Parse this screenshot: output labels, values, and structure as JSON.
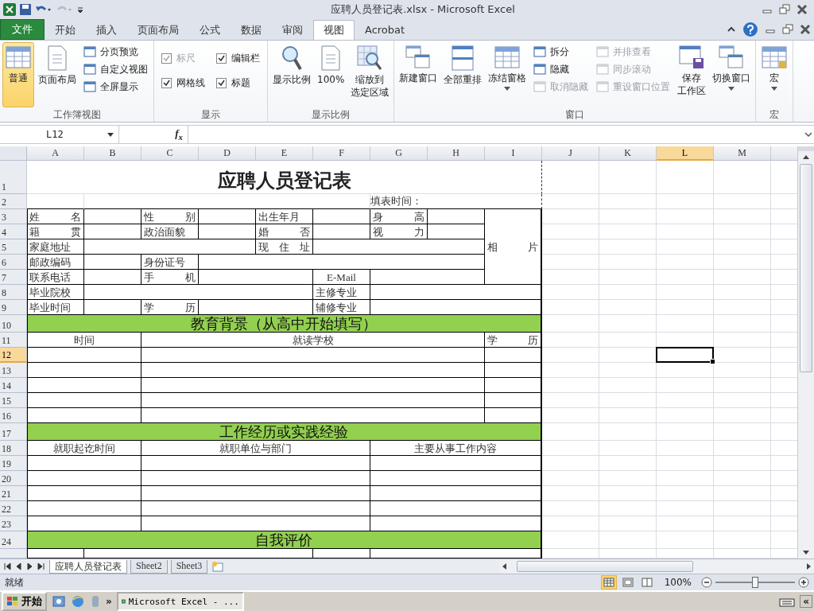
{
  "window": {
    "title": "应聘人员登记表.xlsx - Microsoft Excel"
  },
  "ribbon": {
    "file_tab": "文件",
    "tabs": [
      {
        "label": "开始",
        "selected": false
      },
      {
        "label": "插入",
        "selected": false
      },
      {
        "label": "页面布局",
        "selected": false
      },
      {
        "label": "公式",
        "selected": false
      },
      {
        "label": "数据",
        "selected": false
      },
      {
        "label": "审阅",
        "selected": false
      },
      {
        "label": "视图",
        "selected": true
      },
      {
        "label": "Acrobat",
        "selected": false
      }
    ],
    "groups": [
      {
        "label": "工作簿视图",
        "items": [
          {
            "kind": "large",
            "label": "普通",
            "selected": true,
            "dropdown": false
          },
          {
            "kind": "large",
            "label": "页面布局",
            "selected": false,
            "dropdown": false
          },
          {
            "kind": "small",
            "label": "分页预览",
            "disabled": false
          },
          {
            "kind": "small",
            "label": "自定义视图",
            "disabled": false
          },
          {
            "kind": "small",
            "label": "全屏显示",
            "disabled": false
          }
        ]
      },
      {
        "label": "显示",
        "items": [
          {
            "kind": "check",
            "label": "标尺",
            "checked": true,
            "disabled": true
          },
          {
            "kind": "check",
            "label": "网格线",
            "checked": true,
            "disabled": false
          },
          {
            "kind": "check",
            "label": "编辑栏",
            "checked": true,
            "disabled": false
          },
          {
            "kind": "check",
            "label": "标题",
            "checked": true,
            "disabled": false
          }
        ]
      },
      {
        "label": "显示比例",
        "items": [
          {
            "kind": "large",
            "label": "显示比例",
            "selected": false,
            "dropdown": false
          },
          {
            "kind": "large",
            "label": "100%",
            "selected": false,
            "dropdown": false
          },
          {
            "kind": "large",
            "label": "缩放到",
            "label_2": "选定区域",
            "selected": false,
            "dropdown": false
          }
        ]
      },
      {
        "label": "窗口",
        "items": [
          {
            "kind": "large",
            "label": "新建窗口",
            "selected": false,
            "dropdown": false
          },
          {
            "kind": "large",
            "label": "全部重排",
            "selected": false,
            "dropdown": false
          },
          {
            "kind": "large",
            "label": "冻结窗格",
            "selected": false,
            "dropdown": true
          },
          {
            "kind": "small",
            "label": "拆分",
            "disabled": false
          },
          {
            "kind": "small",
            "label": "隐藏",
            "disabled": false
          },
          {
            "kind": "small",
            "label": "取消隐藏",
            "disabled": true
          },
          {
            "kind": "small",
            "label": "并排查看",
            "disabled": true
          },
          {
            "kind": "small",
            "label": "同步滚动",
            "disabled": true
          },
          {
            "kind": "small",
            "label": "重设窗口位置",
            "disabled": true
          },
          {
            "kind": "large",
            "label": "保存",
            "label_2": "工作区",
            "selected": false,
            "dropdown": false
          },
          {
            "kind": "large",
            "label": "切换窗口",
            "selected": false,
            "dropdown": true
          }
        ]
      },
      {
        "label": "宏",
        "items": [
          {
            "kind": "large",
            "label": "宏",
            "selected": false,
            "dropdown": true
          }
        ]
      }
    ]
  },
  "formula_bar": {
    "name_box": "L12",
    "fx": "f$_{x}$"
  },
  "sheet": {
    "column_headers": [
      {
        "label": "A",
        "selected": false
      },
      {
        "label": "B",
        "selected": false
      },
      {
        "label": "C",
        "selected": false
      },
      {
        "label": "D",
        "selected": false
      },
      {
        "label": "E",
        "selected": false
      },
      {
        "label": "F",
        "selected": false
      },
      {
        "label": "G",
        "selected": false
      },
      {
        "label": "H",
        "selected": false
      },
      {
        "label": "I",
        "selected": false
      },
      {
        "label": "J",
        "selected": false
      },
      {
        "label": "K",
        "selected": false
      },
      {
        "label": "L",
        "selected": true
      },
      {
        "label": "M",
        "selected": false
      }
    ],
    "row_headers": [
      {
        "label": "1",
        "selected": false
      },
      {
        "label": "2",
        "selected": false
      },
      {
        "label": "3",
        "selected": false
      },
      {
        "label": "4",
        "selected": false
      },
      {
        "label": "5",
        "selected": false
      },
      {
        "label": "6",
        "selected": false
      },
      {
        "label": "7",
        "selected": false
      },
      {
        "label": "8",
        "selected": false
      },
      {
        "label": "9",
        "selected": false
      },
      {
        "label": "10",
        "selected": false
      },
      {
        "label": "11",
        "selected": false
      },
      {
        "label": "12",
        "selected": true
      },
      {
        "label": "13",
        "selected": false
      },
      {
        "label": "14",
        "selected": false
      },
      {
        "label": "15",
        "selected": false
      },
      {
        "label": "16",
        "selected": false
      },
      {
        "label": "17",
        "selected": false
      },
      {
        "label": "18",
        "selected": false
      },
      {
        "label": "19",
        "selected": false
      },
      {
        "label": "20",
        "selected": false
      },
      {
        "label": "21",
        "selected": false
      },
      {
        "label": "22",
        "selected": false
      },
      {
        "label": "23",
        "selected": false
      },
      {
        "label": "24",
        "selected": false
      }
    ],
    "title": "应聘人员登记表",
    "fill_time": "填表时间：",
    "photo": "相 片",
    "fields": [
      "姓 名",
      "性 别",
      "出生年月",
      "身 高",
      "籍 贯",
      "政治面貌",
      "婚 否",
      "视 力",
      "家庭地址",
      "现 住 址",
      "邮政编码",
      "身份证号",
      "联系电话",
      "手 机",
      "E-Mail",
      "毕业院校",
      "主修专业",
      "毕业时间",
      "学 历",
      "辅修专业"
    ],
    "education": {
      "heading": "教育背景（从高中开始填写）",
      "columns": [
        "时间",
        "就读学校",
        "学 历"
      ]
    },
    "work": {
      "heading": "工作经历或实践经验",
      "columns": [
        "就职起讫时间",
        "就职单位与部门",
        "主要从事工作内容"
      ]
    },
    "self_review": {
      "heading": "自我评价"
    }
  },
  "sheet_tabs": [
    {
      "label": "应聘人员登记表",
      "selected": true
    },
    {
      "label": "Sheet2",
      "selected": false
    },
    {
      "label": "Sheet3",
      "selected": false
    }
  ],
  "status_bar": {
    "status": "就绪",
    "views": [
      {
        "selected": true
      },
      {
        "selected": false
      },
      {
        "selected": false
      }
    ],
    "zoom": "100%",
    "zoom_slider": {
      "level": 0.5
    }
  },
  "taskbar": {
    "start": "开始",
    "overflow": "»",
    "task": "Microsoft Excel - ...",
    "tray_toggle": "«"
  }
}
